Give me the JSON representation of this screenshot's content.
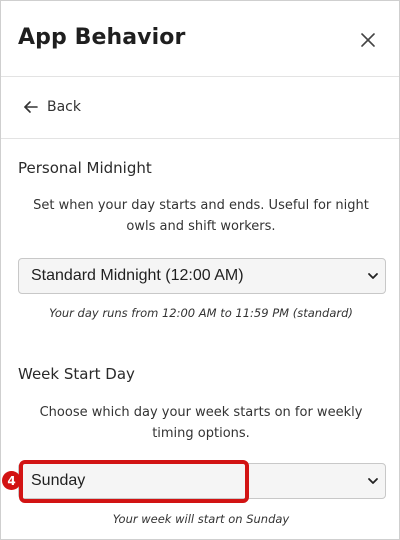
{
  "window": {
    "title": "App Behavior",
    "close_icon": "close-icon"
  },
  "nav": {
    "back_label": "Back",
    "back_icon": "arrow-left-icon"
  },
  "personal_midnight": {
    "title": "Personal Midnight",
    "description": "Set when your day starts and ends. Useful for night owls and shift workers.",
    "selected": "Standard Midnight (12:00 AM)",
    "note": "Your day runs from 12:00 AM to 11:59 PM (standard)"
  },
  "week_start": {
    "title": "Week Start Day",
    "description": "Choose which day your week starts on for weekly timing options.",
    "selected": "Sunday",
    "note": "Your week will start on Sunday"
  },
  "annotation": {
    "badge_number": "4",
    "color": "#d21313"
  }
}
